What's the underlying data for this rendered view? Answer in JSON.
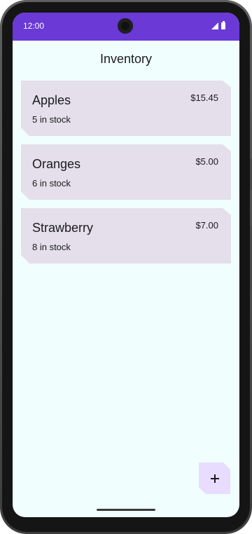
{
  "status_bar": {
    "time": "12:00",
    "icons": [
      "signal-icon",
      "battery-icon"
    ]
  },
  "app": {
    "title": "Inventory"
  },
  "items": [
    {
      "name": "Apples",
      "price": "$15.45",
      "stock": "5 in stock"
    },
    {
      "name": "Oranges",
      "price": "$5.00",
      "stock": "6 in stock"
    },
    {
      "name": "Strawberry",
      "price": "$7.00",
      "stock": "8 in stock"
    }
  ],
  "fab": {
    "icon": "plus-icon"
  },
  "colors": {
    "status_bar": "#6a39d6",
    "background": "#f0fffd",
    "card": "#e4dfea",
    "fab": "#e8dcff"
  }
}
